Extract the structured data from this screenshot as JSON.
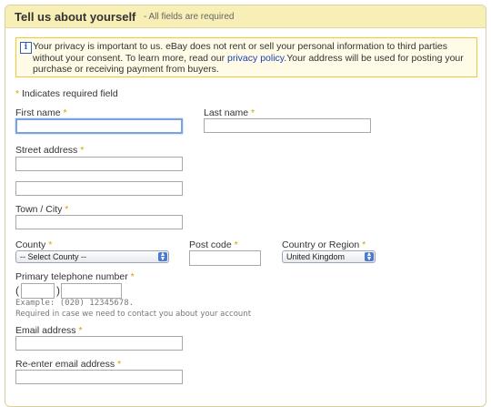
{
  "header": {
    "title": "Tell us about yourself",
    "subtitle": "- All fields are required"
  },
  "notice": {
    "icon": "info-icon",
    "icon_glyph": "i",
    "text_before": "Your privacy is important to us. eBay does not rent or sell your personal information to third parties without your consent. To learn more, read our ",
    "link": "privacy policy.",
    "text_after": "Your address will be used for posting your purchase or receiving payment from buyers."
  },
  "required_note": {
    "star": "*",
    "text": " Indicates required field"
  },
  "fields": {
    "first_name": {
      "label": "First name",
      "value": ""
    },
    "last_name": {
      "label": "Last name",
      "value": ""
    },
    "street_address": {
      "label": "Street address",
      "line1": "",
      "line2": ""
    },
    "town_city": {
      "label": "Town / City",
      "value": ""
    },
    "county": {
      "label": "County",
      "selected": "-- Select County --"
    },
    "post_code": {
      "label": "Post code",
      "value": ""
    },
    "country": {
      "label": "Country or Region",
      "selected": "United Kingdom"
    },
    "phone": {
      "label": "Primary telephone number",
      "open_paren": "(",
      "close_paren": ")",
      "example": "Example: (020) 12345678.",
      "required_hint": "Required in case we need to contact you about your account"
    },
    "email": {
      "label": "Email address",
      "value": ""
    },
    "reenter_email": {
      "label": "Re-enter email address",
      "value": ""
    }
  },
  "required_star": "*",
  "colors": {
    "header_bg": "#f7efb6",
    "notice_border": "#f0c93a",
    "link": "#1a3fb4",
    "required_star": "#d0a300"
  }
}
